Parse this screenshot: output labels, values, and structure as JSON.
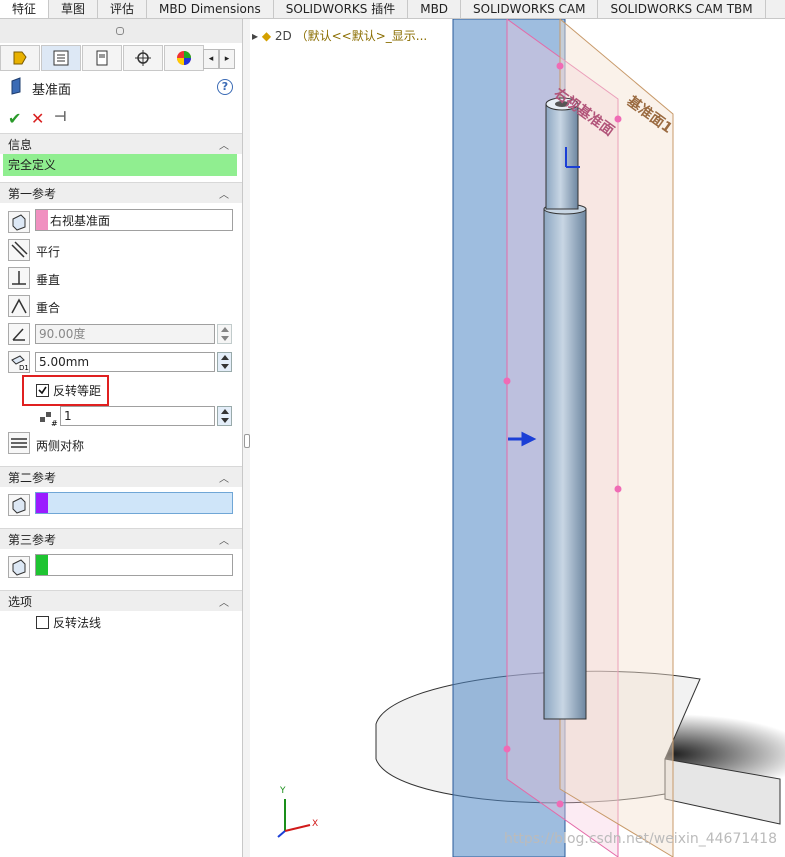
{
  "tabs": [
    "特征",
    "草图",
    "评估",
    "MBD Dimensions",
    "SOLIDWORKS 插件",
    "MBD",
    "SOLIDWORKS CAM",
    "SOLIDWORKS CAM TBM"
  ],
  "panel": {
    "title": "基准面",
    "help": "?",
    "info_header": "信息",
    "status": "完全定义",
    "status_color": "#90ee90",
    "first_ref_header": "第一参考",
    "first_ref_value": "右视基准面",
    "first_ref_color": "#f090c0",
    "opt_parallel": "平行",
    "opt_perpendicular": "垂直",
    "opt_coincident": "重合",
    "angle_value": "90.00度",
    "offset_value": "5.00mm",
    "flip_offset_label": "反转等距",
    "flip_offset_checked": true,
    "instances_value": "1",
    "mid_plane_label": "两侧对称",
    "second_ref_header": "第二参考",
    "second_ref_color": "#9b1bff",
    "third_ref_header": "第三参考",
    "third_ref_color": "#1ec431",
    "options_header": "选项",
    "flip_normal_label": "反转法线",
    "flip_normal_checked": false
  },
  "viewport": {
    "crumb_label": "2D",
    "crumb_value": "（默认<<默认>_显示...",
    "plane1_label": "右视基准面",
    "plane2_label": "基准面1",
    "axis_x": "X",
    "axis_y": "Y",
    "watermark": "https://blog.csdn.net/weixin_44671418"
  }
}
